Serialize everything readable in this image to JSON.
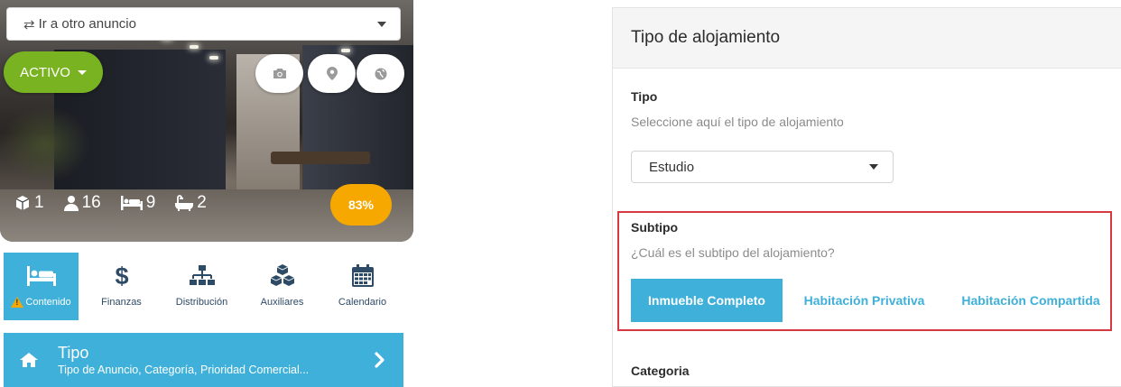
{
  "listing": {
    "goto_label": "Ir a otro anuncio",
    "status_label": "ACTIVO",
    "completion": "83%",
    "stats": [
      {
        "icon": "cube-icon",
        "value": "1"
      },
      {
        "icon": "user-icon",
        "value": "16"
      },
      {
        "icon": "bed-icon",
        "value": "9"
      },
      {
        "icon": "bath-icon",
        "value": "2"
      }
    ],
    "actions": [
      "camera-icon",
      "map-pin-icon",
      "globe-icon"
    ]
  },
  "tabs": [
    {
      "label": "Contenido",
      "icon": "bed-icon",
      "active": true,
      "warning": true
    },
    {
      "label": "Finanzas",
      "icon": "dollar-icon",
      "active": false
    },
    {
      "label": "Distribución",
      "icon": "sitemap-icon",
      "active": false
    },
    {
      "label": "Auxiliares",
      "icon": "cubes-icon",
      "active": false
    },
    {
      "label": "Calendario",
      "icon": "calendar-icon",
      "active": false
    }
  ],
  "section": {
    "title": "Tipo",
    "subtitle": "Tipo de Anuncio, Categoría, Prioridad Comercial..."
  },
  "panel": {
    "title": "Tipo de alojamiento",
    "tipo": {
      "label": "Tipo",
      "help": "Seleccione aquí el tipo de alojamiento",
      "value": "Estudio"
    },
    "subtipo": {
      "label": "Subtipo",
      "help": "¿Cuál es el subtipo del alojamiento?",
      "options": [
        "Inmueble Completo",
        "Habitación Privativa",
        "Habitación Compartida"
      ],
      "selected": "Inmueble Completo"
    },
    "categoria_label": "Categoria"
  },
  "colors": {
    "accent": "#3fb0d9",
    "status_green": "#7ab321",
    "completion_orange": "#f7a800",
    "highlight_red": "#d6393f"
  }
}
